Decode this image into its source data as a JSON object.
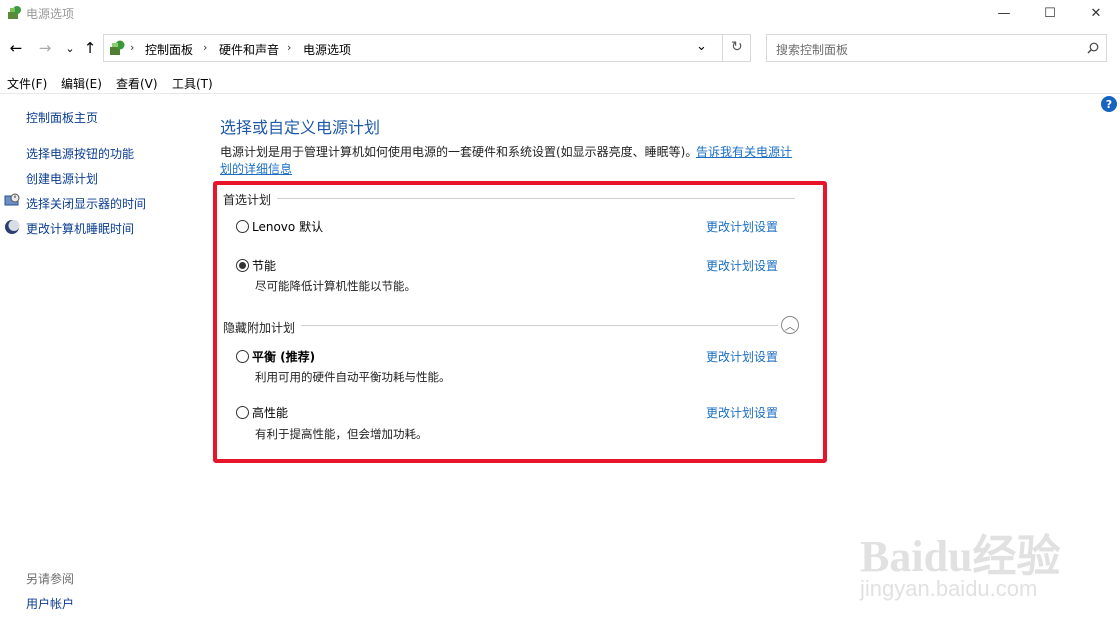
{
  "window": {
    "title": "电源选项",
    "minimize": "—",
    "maximize": "☐",
    "close": "✕"
  },
  "nav": {
    "back": "←",
    "forward": "→",
    "recent": "⌄",
    "up": "↑",
    "breadcrumbs": [
      "控制面板",
      "硬件和声音",
      "电源选项"
    ],
    "dropdown": "⌄",
    "refresh": "↻",
    "search_placeholder": "搜索控制面板"
  },
  "menu": {
    "file": "文件(F)",
    "edit": "编辑(E)",
    "view": "查看(V)",
    "tools": "工具(T)"
  },
  "left_pane": {
    "home": "控制面板主页",
    "links": [
      "选择电源按钮的功能",
      "创建电源计划",
      "选择关闭显示器的时间",
      "更改计算机睡眠时间"
    ],
    "see_also_heading": "另请参阅",
    "see_also_links": [
      "用户帐户"
    ]
  },
  "main": {
    "heading": "选择或自定义电源计划",
    "description": "电源计划是用于管理计算机如何使用电源的一套硬件和系统设置(如显示器亮度、睡眠等)。",
    "description_link_line1": "告诉我有关电源计",
    "description_link_line2": "划的详细信息",
    "preferred_group": "首选计划",
    "hidden_group": "隐藏附加计划",
    "plans": [
      {
        "name": "Lenovo 默认",
        "desc": "",
        "selected": false,
        "action": "更改计划设置"
      },
      {
        "name": "节能",
        "desc": "尽可能降低计算机性能以节能。",
        "selected": true,
        "action": "更改计划设置"
      },
      {
        "name": "平衡 (推荐)",
        "desc": "利用可用的硬件自动平衡功耗与性能。",
        "selected": false,
        "action": "更改计划设置"
      },
      {
        "name": "高性能",
        "desc": "有利于提高性能，但会增加功耗。",
        "selected": false,
        "action": "更改计划设置"
      }
    ]
  },
  "help": "?",
  "watermark": {
    "brand": "Baidu经验",
    "url": "jingyan.baidu.com"
  },
  "colors": {
    "highlight_border": "#e8142a",
    "link": "#1a6fc4",
    "heading": "#1e5aa8"
  }
}
